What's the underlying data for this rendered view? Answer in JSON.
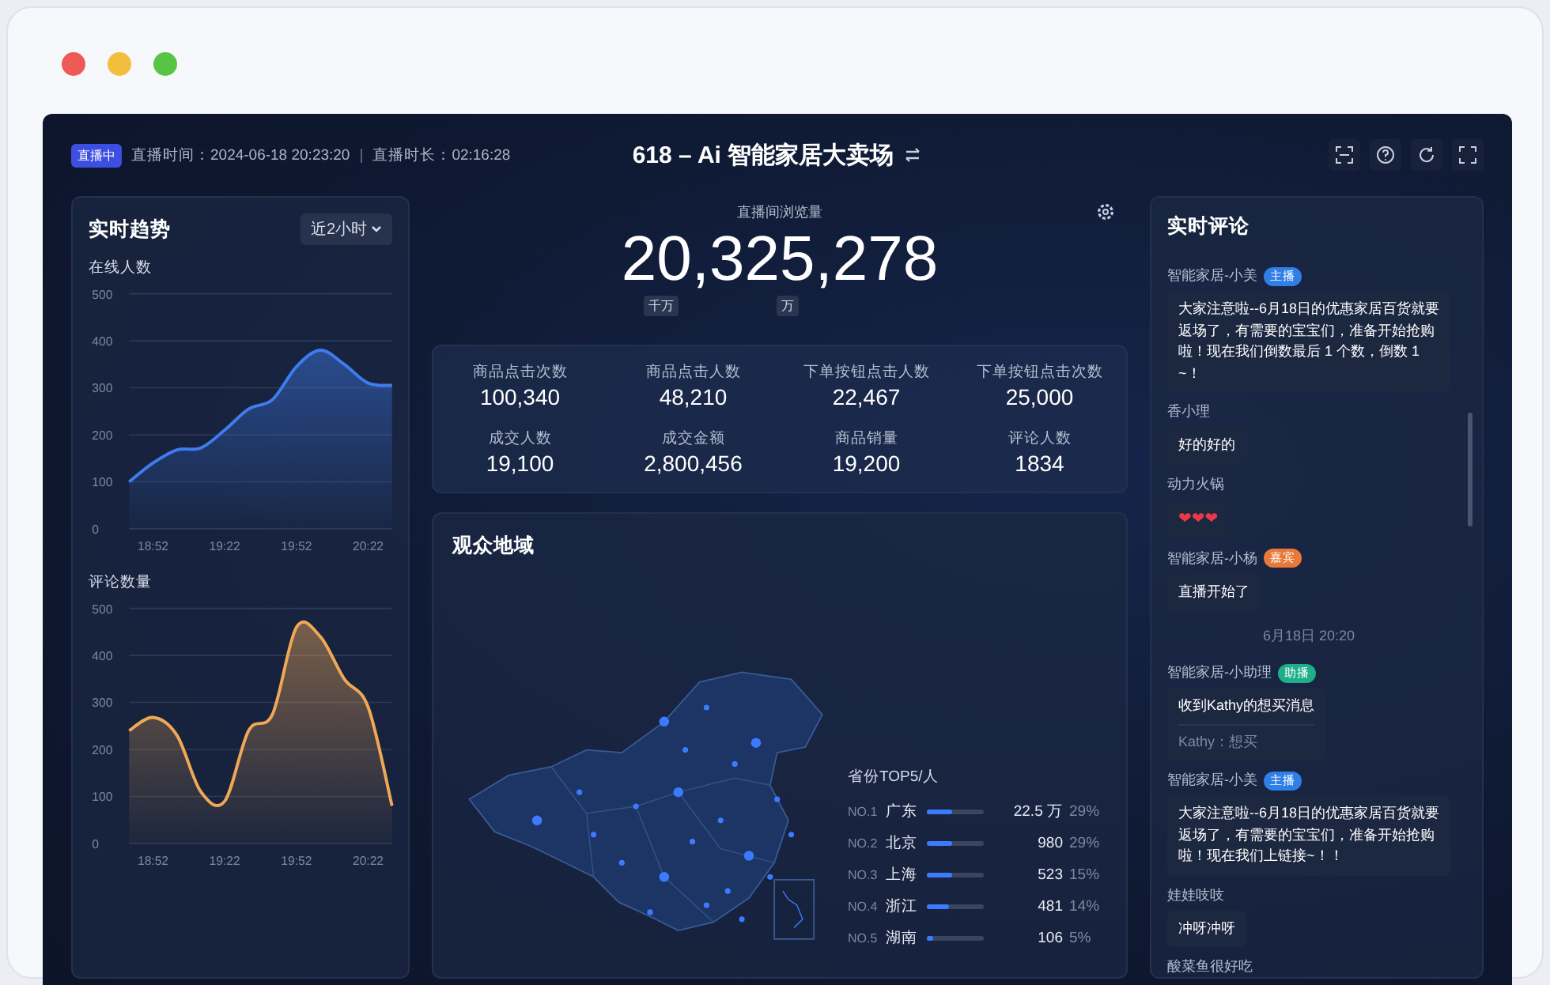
{
  "header": {
    "live_badge": "直播中",
    "live_time": "直播时间：2024-06-18 20:23:20",
    "separator": "|",
    "duration": "直播时长：02:16:28",
    "title": "618 – Ai 智能家居大卖场"
  },
  "trend": {
    "title": "实时趋势",
    "range": "近2小时",
    "charts": [
      {
        "chart_data": {
          "type": "area",
          "grid": true,
          "categories": [
            null,
            "18:52",
            null,
            null,
            "19:22",
            null,
            null,
            "19:52",
            null,
            null,
            "20:22",
            null
          ],
          "ylim": [
            0,
            500
          ],
          "yticks": [
            0,
            100,
            200,
            300,
            400,
            500
          ],
          "series": [
            {
              "name": "在线人数",
              "color": "#3f7cf0",
              "values": [
                100,
                140,
                168,
                172,
                210,
                255,
                275,
                345,
                380,
                350,
                310,
                305
              ]
            }
          ]
        }
      },
      {
        "chart_data": {
          "type": "area",
          "grid": true,
          "categories": [
            null,
            "18:52",
            null,
            null,
            "19:22",
            null,
            null,
            "19:52",
            null,
            null,
            "20:22",
            null
          ],
          "ylim": [
            0,
            500
          ],
          "yticks": [
            0,
            100,
            200,
            300,
            400,
            500
          ],
          "series": [
            {
              "name": "评论数量",
              "color": "#f0a857",
              "values": [
                240,
                268,
                230,
                110,
                90,
                240,
                275,
                460,
                440,
                350,
                290,
                80
              ]
            }
          ]
        }
      }
    ]
  },
  "views": {
    "label": "直播间浏览量",
    "value": "20,325,278",
    "units": [
      "千万",
      "万"
    ]
  },
  "stats": [
    {
      "label": "商品点击次数",
      "value": "100,340"
    },
    {
      "label": "商品点击人数",
      "value": "48,210"
    },
    {
      "label": "下单按钮点击人数",
      "value": "22,467"
    },
    {
      "label": "下单按钮点击次数",
      "value": "25,000"
    },
    {
      "label": "成交人数",
      "value": "19,100"
    },
    {
      "label": "成交金额",
      "value": "2,800,456"
    },
    {
      "label": "商品销量",
      "value": "19,200"
    },
    {
      "label": "评论人数",
      "value": "1834"
    }
  ],
  "region": {
    "title": "观众地域",
    "top_title": "省份TOP5/人",
    "rows": [
      {
        "rank": "NO.1",
        "province": "广东",
        "level": 0.45,
        "count": "22.5 万",
        "percent": "29%"
      },
      {
        "rank": "NO.2",
        "province": "北京",
        "level": 0.45,
        "count": "980",
        "percent": "29%"
      },
      {
        "rank": "NO.3",
        "province": "上海",
        "level": 0.45,
        "count": "523",
        "percent": "15%"
      },
      {
        "rank": "NO.4",
        "province": "浙江",
        "level": 0.4,
        "count": "481",
        "percent": "14%"
      },
      {
        "rank": "NO.5",
        "province": "湖南",
        "level": 0.1,
        "count": "106",
        "percent": "5%"
      }
    ]
  },
  "comments": {
    "title": "实时评论",
    "items": [
      {
        "kind": "message",
        "author": "智能家居-小美",
        "badge": "主播",
        "color": "#2f7fe6",
        "text": "大家注意啦--6月18日的优惠家居百货就要返场了，有需要的宝宝们，准备开始抢购啦！现在我们倒数最后 1 个数，倒数 1 ~！"
      },
      {
        "kind": "message",
        "author": "香小理",
        "text": "好的好的"
      },
      {
        "kind": "emoji",
        "author": "动力火锅",
        "text": "❤❤❤"
      },
      {
        "kind": "message",
        "author": "智能家居-小杨",
        "badge": "嘉宾",
        "color": "#e8793a",
        "text": "直播开始了"
      },
      {
        "kind": "time",
        "text": "6月18日 20:20"
      },
      {
        "kind": "message",
        "author": "智能家居-小助理",
        "badge": "助播",
        "color": "#1fae8a",
        "text": "收到Kathy的想买消息",
        "quote": "Kathy：想买"
      },
      {
        "kind": "message",
        "author": "智能家居-小美",
        "badge": "主播",
        "color": "#2f7fe6",
        "text": "大家注意啦--6月18日的优惠家居百货就要返场了，有需要的宝宝们，准备开始抢购啦！现在我们上链接~！！"
      },
      {
        "kind": "message",
        "author": "娃娃吱吱",
        "text": "冲呀冲呀"
      },
      {
        "kind": "message",
        "author": "酸菜鱼很好吃"
      }
    ]
  }
}
